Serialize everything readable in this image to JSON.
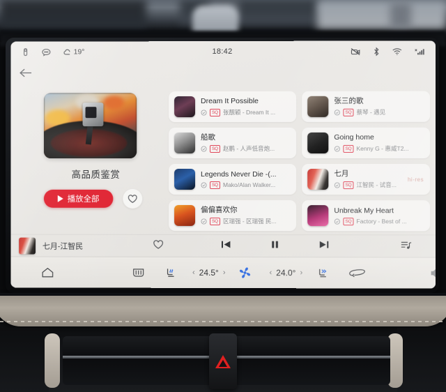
{
  "status_bar": {
    "bluetooth_audio_icon": "paperclip-icon",
    "message_icon": "message-icon",
    "weather_icon": "cloud-icon",
    "outside_temp": "19°",
    "time": "18:42",
    "camera_off_icon": "camera-off-icon",
    "bt_icon": "bluetooth-icon",
    "wifi_icon": "wifi-icon",
    "signal_icon": "signal-icon"
  },
  "nav": {
    "back_label": "←"
  },
  "album": {
    "title": "高品质鉴赏",
    "play_all_label": "播放全部",
    "cover_alt": "turntable-vinyl-record",
    "favorite_icon": "heart-icon"
  },
  "songs": [
    {
      "title": "Dream It Possible",
      "artist": "张靓颖 - Dream It ...",
      "badge": "SQ",
      "verified": true,
      "thumb": "linear-gradient(150deg,#2a1f2e 0%,#6b3a52 45%,#1b1419 100%)",
      "hires": ""
    },
    {
      "title": "张三的歌",
      "artist": "蔡琴 - 遇见",
      "badge": "SQ",
      "verified": true,
      "thumb": "linear-gradient(150deg,#8d7f72 0%,#5a4d43 50%,#241d18 100%)",
      "hires": ""
    },
    {
      "title": "船歌",
      "artist": "赵鹏 - 人声低音炮...",
      "badge": "SQ",
      "verified": true,
      "thumb": "linear-gradient(150deg,#d9d9d9 0%,#8f8f8f 45%,#2c2c2c 100%)",
      "hires": ""
    },
    {
      "title": "Going home",
      "artist": "Kenny G - 惠威T2...",
      "badge": "SQ",
      "verified": true,
      "thumb": "linear-gradient(150deg,#3a3a3a 0%,#141414 55%,#000 100%)",
      "hires": ""
    },
    {
      "title": "Legends Never Die -(...",
      "artist": "Mako/Alan Walker...",
      "badge": "SQ",
      "verified": true,
      "thumb": "linear-gradient(150deg,#1b3a6b 0%,#2a5fa8 45%,#0a1422 100%)",
      "hires": ""
    },
    {
      "title": "七月",
      "artist": "江智民 - 试音...",
      "badge": "SQ",
      "verified": true,
      "thumb": "linear-gradient(110deg,#c42f2c 0%,#e0584a 30%,#f0eae3 55%,#2a2623 80%,#101010 100%)",
      "hires": "hi-res"
    },
    {
      "title": "偏偏喜欢你",
      "artist": "区瑞强 - 区瑞强 民...",
      "badge": "SQ",
      "verified": true,
      "thumb": "linear-gradient(160deg,#f0a02a 0%,#d9541f 45%,#8a2410 100%)",
      "hires": ""
    },
    {
      "title": "Unbreak My Heart",
      "artist": "Factory - Best of ...",
      "badge": "SQ",
      "verified": true,
      "thumb": "linear-gradient(160deg,#2a1020 0%,#b02a6e 55%,#e85fa0 100%)",
      "hires": ""
    }
  ],
  "player": {
    "now_playing": "七月-江智民",
    "favorite_icon": "heart-icon",
    "prev_icon": "previous-track-icon",
    "play_pause_icon": "pause-icon",
    "next_icon": "next-track-icon",
    "queue_icon": "playlist-queue-icon"
  },
  "climate": {
    "home_icon": "home-icon",
    "rear_defrost_icon": "rear-defrost-icon",
    "seat_heat_icon": "heated-seat-icon",
    "driver_temp": "24.5°",
    "passenger_temp": "24.0°",
    "fan_icon": "fan-icon",
    "seat_cool_icon": "ventilated-seat-icon",
    "recirculate_icon": "air-recirculation-icon",
    "volume_icon": "volume-icon",
    "chevron_left": "‹",
    "chevron_right": "›"
  },
  "dashboard": {
    "hazard_icon": "hazard-triangle-icon"
  }
}
